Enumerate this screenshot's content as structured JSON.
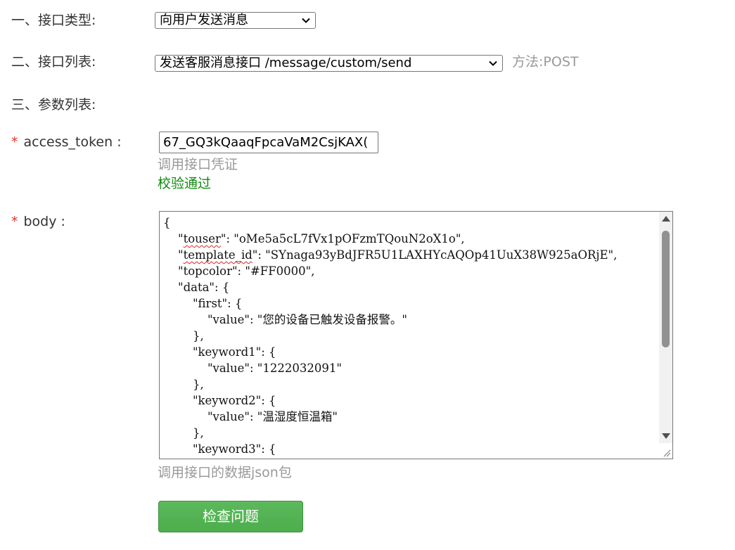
{
  "form": {
    "interface_type_label": "一、接口类型:",
    "interface_type_value": "向用户发送消息",
    "interface_list_label": "二、接口列表:",
    "interface_list_value": "发送客服消息接口 /message/custom/send",
    "method_text": "方法:POST",
    "params_label": "三、参数列表:",
    "required_mark": "*",
    "access_token_label": "access_token :",
    "access_token_value": "67_GQ3kQaaqFpcaVaM2CsjKAX(",
    "access_token_hint": "调用接口凭证",
    "access_token_status": "校验通过",
    "body_label": "body :",
    "body_hint": "调用接口的数据json包",
    "submit_label": "检查问题"
  },
  "body_code": {
    "l1": "{",
    "l2_pre": "    \"",
    "l2_key": "touser",
    "l2_post": "\": \"oMe5a5cL7fVx1pOFzmTQouN2oX1o\",",
    "l3_pre": "    \"",
    "l3_key": "template_id",
    "l3_post": "\": \"SYnaga93yBdJFR5U1LAXHYcAQOp41UuX38W925aORjE\",",
    "l4": "    \"topcolor\": \"#FF0000\",",
    "l5": "    \"data\": {",
    "l6": "        \"first\": {",
    "l7": "            \"value\": \"您的设备已触发设备报警。\"",
    "l8": "        },",
    "l9": "        \"keyword1\": {",
    "l10": "            \"value\": \"1222032091\"",
    "l11": "        },",
    "l12": "        \"keyword2\": {",
    "l13": "            \"value\": \"温湿度恒温箱\"",
    "l14": "        },",
    "l15": "        \"keyword3\": {"
  },
  "icons": {
    "select_arrow": "chevron-down-icon",
    "scroll_up": "arrow-up-icon",
    "scroll_down": "arrow-down-icon",
    "resize": "resize-grip-icon"
  },
  "colors": {
    "required": "#d9362b",
    "success": "#118a11",
    "hint": "#999999",
    "button": "#5cb85c"
  }
}
